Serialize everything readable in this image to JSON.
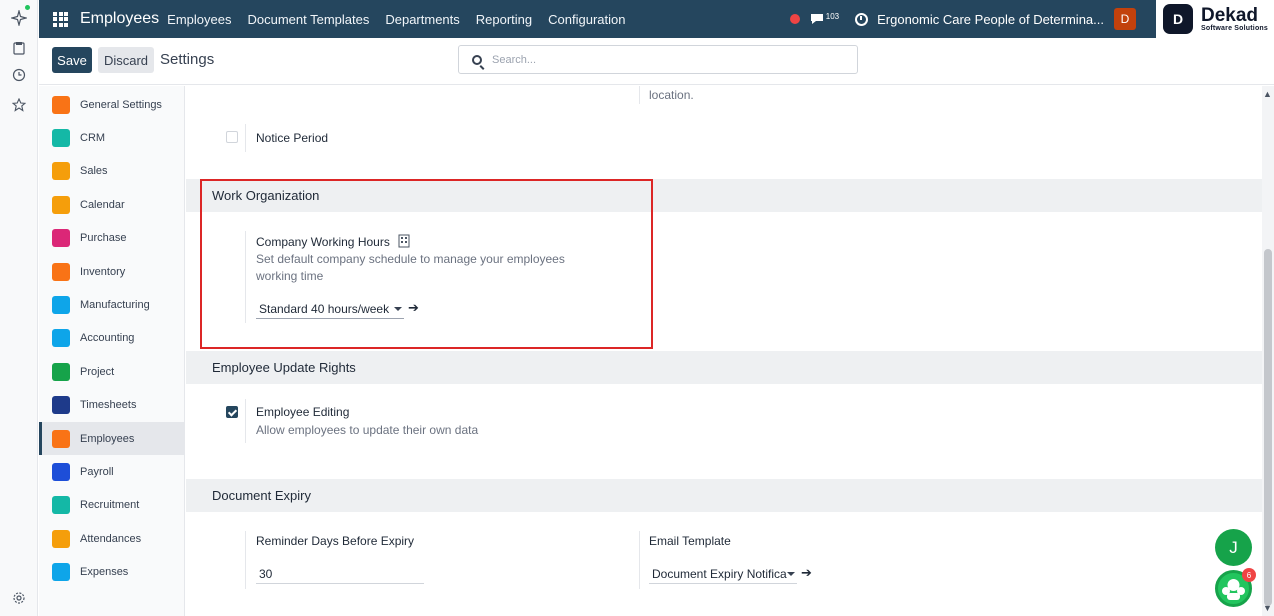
{
  "topbar": {
    "app_name": "Employees",
    "menu": [
      "Employees",
      "Document Templates",
      "Departments",
      "Reporting",
      "Configuration"
    ],
    "messages_count": "103",
    "company": "Ergonomic Care People of Determina...",
    "user_initial": "D",
    "logo_letter": "D",
    "logo_name": "Dekad",
    "logo_tagline": "Software Solutions"
  },
  "control": {
    "save_label": "Save",
    "discard_label": "Discard",
    "title": "Settings",
    "search_placeholder": "Search..."
  },
  "sidebar": {
    "items": [
      {
        "label": "General Settings",
        "icon": "general-settings-icon",
        "color": "#f97316"
      },
      {
        "label": "CRM",
        "icon": "crm-icon",
        "color": "#14b8a6"
      },
      {
        "label": "Sales",
        "icon": "sales-icon",
        "color": "#f59e0b"
      },
      {
        "label": "Calendar",
        "icon": "calendar-icon",
        "color": "#f59e0b"
      },
      {
        "label": "Purchase",
        "icon": "purchase-icon",
        "color": "#db2777"
      },
      {
        "label": "Inventory",
        "icon": "inventory-icon",
        "color": "#f97316"
      },
      {
        "label": "Manufacturing",
        "icon": "manufacturing-icon",
        "color": "#0ea5e9"
      },
      {
        "label": "Accounting",
        "icon": "accounting-icon",
        "color": "#0ea5e9"
      },
      {
        "label": "Project",
        "icon": "project-icon",
        "color": "#16a34a"
      },
      {
        "label": "Timesheets",
        "icon": "timesheets-icon",
        "color": "#1e3a8a"
      },
      {
        "label": "Employees",
        "icon": "employees-icon",
        "color": "#f97316"
      },
      {
        "label": "Payroll",
        "icon": "payroll-icon",
        "color": "#1d4ed8"
      },
      {
        "label": "Recruitment",
        "icon": "recruitment-icon",
        "color": "#14b8a6"
      },
      {
        "label": "Attendances",
        "icon": "attendances-icon",
        "color": "#f59e0b"
      },
      {
        "label": "Expenses",
        "icon": "expenses-icon",
        "color": "#0ea5e9"
      }
    ],
    "active_index": 10
  },
  "content": {
    "location_tail": "location.",
    "notice_period_label": "Notice Period",
    "work_org": {
      "heading": "Work Organization",
      "hours_label": "Company Working Hours",
      "hours_desc_1": "Set default company schedule to manage your employees",
      "hours_desc_2": "working time",
      "hours_value": "Standard 40 hours/week"
    },
    "update_rights": {
      "heading": "Employee Update Rights",
      "editing_label": "Employee Editing",
      "editing_desc": "Allow employees to update their own data"
    },
    "doc_expiry": {
      "heading": "Document Expiry",
      "reminder_label": "Reminder Days Before Expiry",
      "reminder_value": "30",
      "template_label": "Email Template",
      "template_value": "Document Expiry Notifica"
    }
  },
  "fab": {
    "user_initial": "J",
    "bot_badge": "6"
  },
  "colors": {
    "navbar": "#25465e",
    "highlight_box": "#dc2626"
  }
}
